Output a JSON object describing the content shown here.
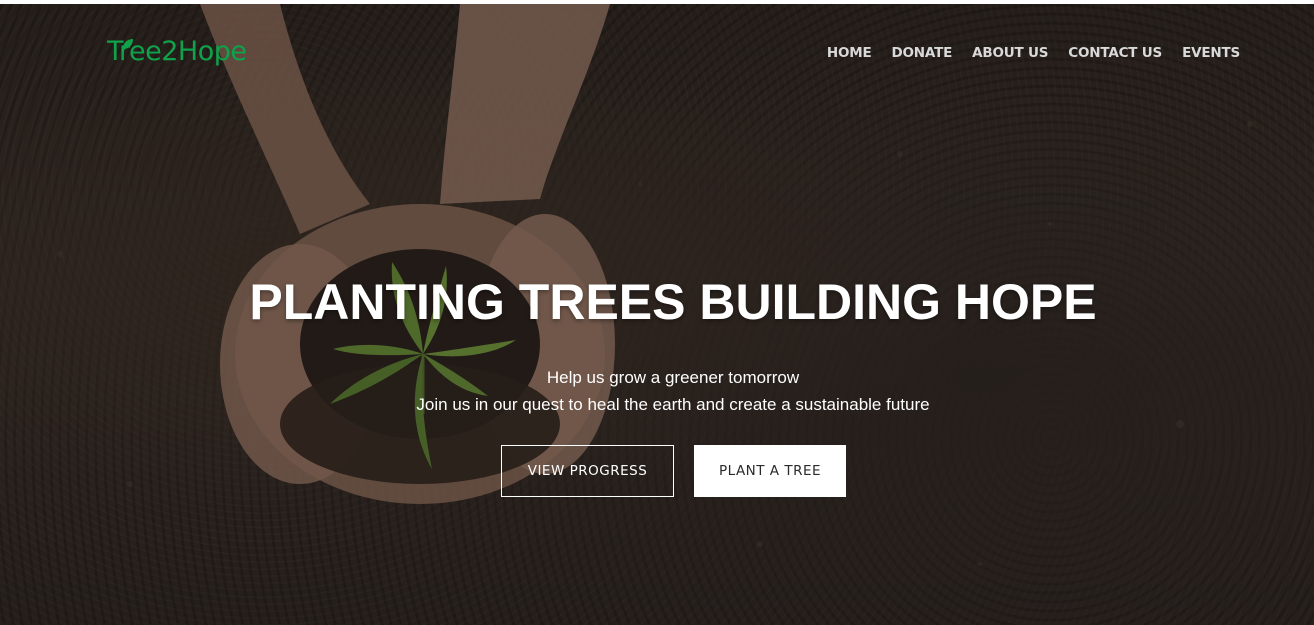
{
  "header": {
    "logo_text": "Tree2Hope",
    "logo_color": "#0fa24a",
    "nav": [
      {
        "label": "HOME"
      },
      {
        "label": "DONATE"
      },
      {
        "label": "ABOUT US"
      },
      {
        "label": "CONTACT US"
      },
      {
        "label": "EVENTS"
      }
    ]
  },
  "hero": {
    "image_subject": "hands-holding-seedling-in-soil",
    "headline": "PLANTING TREES BUILDING HOPE",
    "subline_1": "Help us grow a greener tomorrow",
    "subline_2": "Join us in our quest to heal the earth and create a sustainable future",
    "buttons": {
      "view_progress": "VIEW PROGRESS",
      "plant_tree": "PLANT A TREE"
    }
  },
  "colors": {
    "accent": "#0fa24a",
    "text_light": "#ffffff",
    "nav_text": "#d9d9d9"
  }
}
